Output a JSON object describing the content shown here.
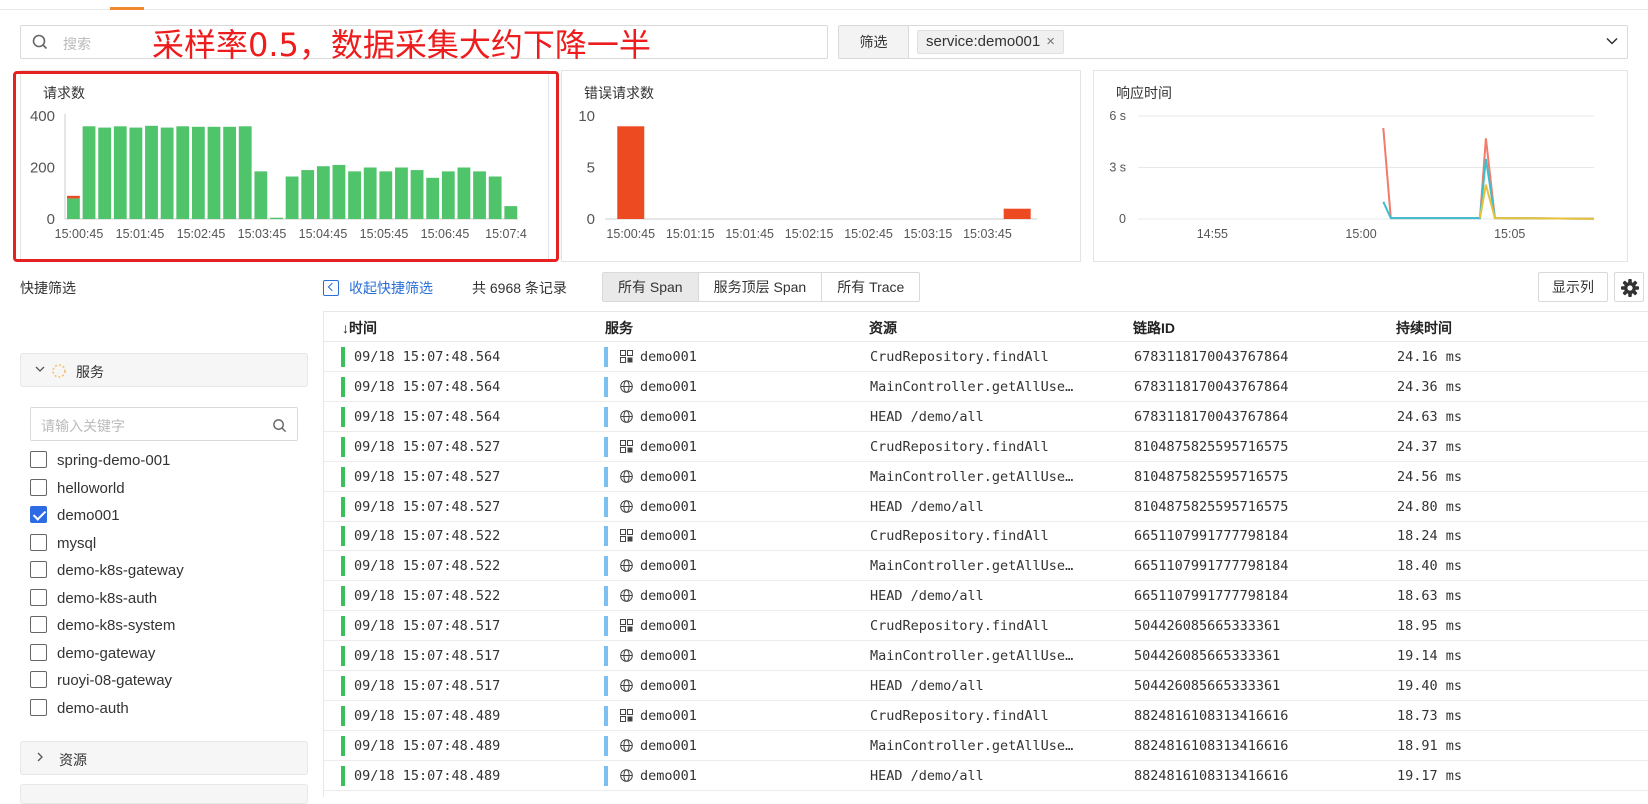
{
  "search": {
    "placeholder": "搜索"
  },
  "annotation": "采样率0.5，数据采集大约下降一半",
  "filter": {
    "label": "筛选",
    "tag": "service:demo001",
    "tag_close": "×"
  },
  "panels": {
    "requests": {
      "title": "请求数"
    },
    "errors": {
      "title": "错误请求数"
    },
    "latency": {
      "title": "响应时间"
    }
  },
  "chart_data": [
    {
      "type": "bar",
      "title": "请求数",
      "yticks": [
        "400",
        "200",
        "0"
      ],
      "ylim": [
        0,
        400
      ],
      "xticks": [
        "15:00:45",
        "15:01:45",
        "15:02:45",
        "15:03:45",
        "15:04:45",
        "15:05:45",
        "15:06:45",
        "15:07:4"
      ],
      "series": [
        {
          "color": "#4fc46a",
          "values": [
            80,
            360,
            355,
            360,
            355,
            362,
            355,
            360,
            358,
            358,
            358,
            360,
            185,
            5,
            165,
            190,
            205,
            210,
            185,
            200,
            185,
            200,
            190,
            160,
            185,
            200,
            185,
            165,
            50
          ]
        },
        {
          "color": "#ee4a22",
          "values": [
            10,
            0,
            0,
            0,
            0,
            0,
            0,
            0,
            0,
            0,
            0,
            0,
            0,
            0,
            0,
            0,
            0,
            0,
            0,
            0,
            0,
            0,
            0,
            0,
            0,
            0,
            0,
            0,
            0
          ]
        }
      ],
      "grid": false
    },
    {
      "type": "bar",
      "title": "错误请求数",
      "yticks": [
        "10",
        "5",
        "0"
      ],
      "ylim": [
        0,
        10
      ],
      "xticks": [
        "15:00:45",
        "15:01:15",
        "15:01:45",
        "15:02:15",
        "15:02:45",
        "15:03:15",
        "15:03:45"
      ],
      "bars": [
        {
          "x": "15:00:45",
          "value": 9
        },
        {
          "x": "15:04:00",
          "value": 1
        }
      ],
      "color": "#ee4a22",
      "grid": false
    },
    {
      "type": "line",
      "title": "响应时间",
      "yticks": [
        "6 s",
        "3 s",
        "0"
      ],
      "ylim": [
        0,
        6
      ],
      "xticks": [
        "14:55",
        "15:00",
        "15:05"
      ],
      "x_range": [
        "14:52:30",
        "15:07:50"
      ],
      "series": [
        {
          "color": "#f07c6a",
          "points": [
            [
              "15:00:45",
              5.3
            ],
            [
              "15:01:00",
              0.05
            ],
            [
              "15:04:00",
              0.05
            ],
            [
              "15:04:12",
              4.7
            ],
            [
              "15:04:30",
              0.05
            ],
            [
              "15:07:50",
              0.02
            ]
          ]
        },
        {
          "color": "#3cbfcf",
          "points": [
            [
              "15:00:45",
              1.0
            ],
            [
              "15:01:00",
              0.05
            ],
            [
              "15:04:00",
              0.05
            ],
            [
              "15:04:12",
              3.5
            ],
            [
              "15:04:30",
              0.05
            ],
            [
              "15:07:50",
              0.02
            ]
          ]
        },
        {
          "color": "#e8c23a",
          "points": [
            [
              "15:04:00",
              0.05
            ],
            [
              "15:04:12",
              2.0
            ],
            [
              "15:04:30",
              0.05
            ],
            [
              "15:07:50",
              0.02
            ]
          ]
        }
      ],
      "grid": true
    }
  ],
  "quick_filter": {
    "title": "快捷筛选",
    "collapse": "收起快捷筛选",
    "record_count": "共 6968 条记录"
  },
  "span_tabs": [
    "所有 Span",
    "服务顶层 Span",
    "所有 Trace"
  ],
  "columns_button": "显示列",
  "facets": {
    "service": {
      "label": "服务",
      "keyword_placeholder": "请输入关键字"
    },
    "resource": {
      "label": "资源"
    }
  },
  "service_options": [
    {
      "name": "spring-demo-001",
      "checked": false
    },
    {
      "name": "helloworld",
      "checked": false
    },
    {
      "name": "demo001",
      "checked": true
    },
    {
      "name": "mysql",
      "checked": false
    },
    {
      "name": "demo-k8s-gateway",
      "checked": false
    },
    {
      "name": "demo-k8s-auth",
      "checked": false
    },
    {
      "name": "demo-k8s-system",
      "checked": false
    },
    {
      "name": "demo-gateway",
      "checked": false
    },
    {
      "name": "ruoyi-08-gateway",
      "checked": false
    },
    {
      "name": "demo-auth",
      "checked": false
    }
  ],
  "table": {
    "headers": {
      "time": "↓时间",
      "service": "服务",
      "resource": "资源",
      "trace_id": "链路ID",
      "duration": "持续时间"
    },
    "rows": [
      {
        "time": "09/18 15:07:48.564",
        "service": "demo001",
        "icon": "db-icon",
        "resource": "CrudRepository.findAll",
        "trace_id": "6783118170043767864",
        "duration": "24.16 ms"
      },
      {
        "time": "09/18 15:07:48.564",
        "service": "demo001",
        "icon": "globe-icon",
        "resource": "MainController.getAllUse…",
        "trace_id": "6783118170043767864",
        "duration": "24.36 ms"
      },
      {
        "time": "09/18 15:07:48.564",
        "service": "demo001",
        "icon": "globe-icon",
        "resource": "HEAD /demo/all",
        "trace_id": "6783118170043767864",
        "duration": "24.63 ms"
      },
      {
        "time": "09/18 15:07:48.527",
        "service": "demo001",
        "icon": "db-icon",
        "resource": "CrudRepository.findAll",
        "trace_id": "8104875825595716575",
        "duration": "24.37 ms"
      },
      {
        "time": "09/18 15:07:48.527",
        "service": "demo001",
        "icon": "globe-icon",
        "resource": "MainController.getAllUse…",
        "trace_id": "8104875825595716575",
        "duration": "24.56 ms"
      },
      {
        "time": "09/18 15:07:48.527",
        "service": "demo001",
        "icon": "globe-icon",
        "resource": "HEAD /demo/all",
        "trace_id": "8104875825595716575",
        "duration": "24.80 ms"
      },
      {
        "time": "09/18 15:07:48.522",
        "service": "demo001",
        "icon": "db-icon",
        "resource": "CrudRepository.findAll",
        "trace_id": "6651107991777798184",
        "duration": "18.24 ms"
      },
      {
        "time": "09/18 15:07:48.522",
        "service": "demo001",
        "icon": "globe-icon",
        "resource": "MainController.getAllUse…",
        "trace_id": "6651107991777798184",
        "duration": "18.40 ms"
      },
      {
        "time": "09/18 15:07:48.522",
        "service": "demo001",
        "icon": "globe-icon",
        "resource": "HEAD /demo/all",
        "trace_id": "6651107991777798184",
        "duration": "18.63 ms"
      },
      {
        "time": "09/18 15:07:48.517",
        "service": "demo001",
        "icon": "db-icon",
        "resource": "CrudRepository.findAll",
        "trace_id": "504426085665333361",
        "duration": "18.95 ms"
      },
      {
        "time": "09/18 15:07:48.517",
        "service": "demo001",
        "icon": "globe-icon",
        "resource": "MainController.getAllUse…",
        "trace_id": "504426085665333361",
        "duration": "19.14 ms"
      },
      {
        "time": "09/18 15:07:48.517",
        "service": "demo001",
        "icon": "globe-icon",
        "resource": "HEAD /demo/all",
        "trace_id": "504426085665333361",
        "duration": "19.40 ms"
      },
      {
        "time": "09/18 15:07:48.489",
        "service": "demo001",
        "icon": "db-icon",
        "resource": "CrudRepository.findAll",
        "trace_id": "8824816108313416616",
        "duration": "18.73 ms"
      },
      {
        "time": "09/18 15:07:48.489",
        "service": "demo001",
        "icon": "globe-icon",
        "resource": "MainController.getAllUse…",
        "trace_id": "8824816108313416616",
        "duration": "18.91 ms"
      },
      {
        "time": "09/18 15:07:48.489",
        "service": "demo001",
        "icon": "globe-icon",
        "resource": "HEAD /demo/all",
        "trace_id": "8824816108313416616",
        "duration": "19.17 ms"
      }
    ]
  }
}
